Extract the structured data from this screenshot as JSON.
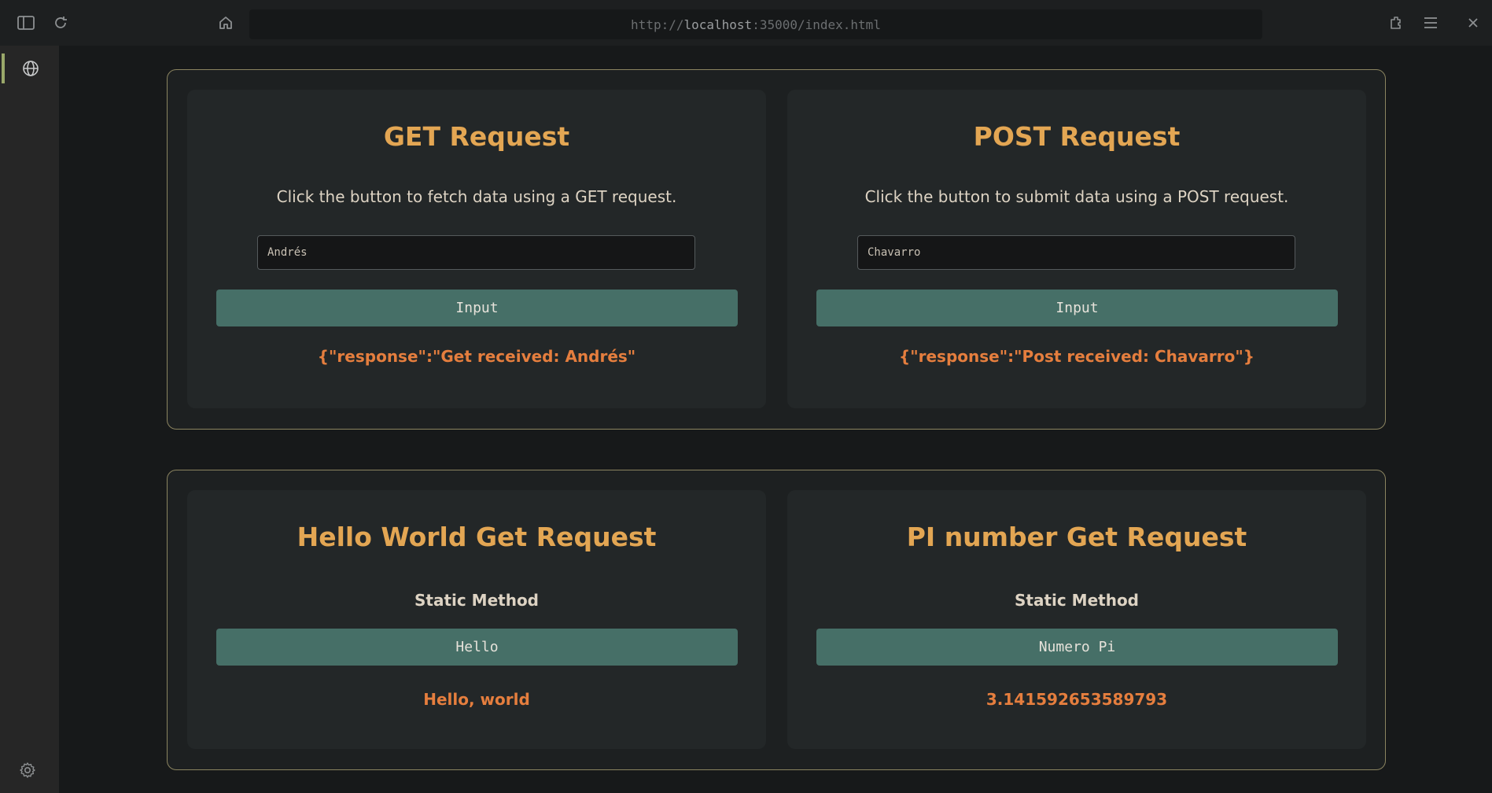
{
  "browser": {
    "url_prefix": "http://",
    "url_host": "localhost",
    "url_rest": ":35000/index.html",
    "icons": [
      "sidebar-toggle-icon",
      "reload-icon",
      "home-icon",
      "extensions-icon",
      "menu-icon",
      "close-icon"
    ]
  },
  "sidebar": {
    "items": [
      {
        "icon": "globe-icon",
        "active": true
      }
    ],
    "footer_icon": "gear-icon"
  },
  "panels": [
    {
      "cards": [
        {
          "title": "GET Request",
          "description": "Click the button to fetch data using a GET request.",
          "input_value": "Andrés",
          "button_label": "Input",
          "result": "{\"response\":\"Get received: Andrés\""
        },
        {
          "title": "POST Request",
          "description": "Click the button to submit data using a POST request.",
          "input_value": "Chavarro",
          "button_label": "Input",
          "result": "{\"response\":\"Post received: Chavarro\"}"
        }
      ]
    },
    {
      "cards": [
        {
          "title": "Hello World Get Request",
          "subtitle": "Static Method",
          "button_label": "Hello",
          "result": "Hello, world"
        },
        {
          "title": "PI number Get Request",
          "subtitle": "Static Method",
          "button_label": "Numero Pi",
          "result": "3.141592653589793"
        }
      ]
    }
  ],
  "colors": {
    "accent_title": "#e3a653",
    "result_text": "#e57e3e",
    "button_bg": "#466f67",
    "panel_border": "#8b8460",
    "sidebar_active": "#9aa86a"
  }
}
